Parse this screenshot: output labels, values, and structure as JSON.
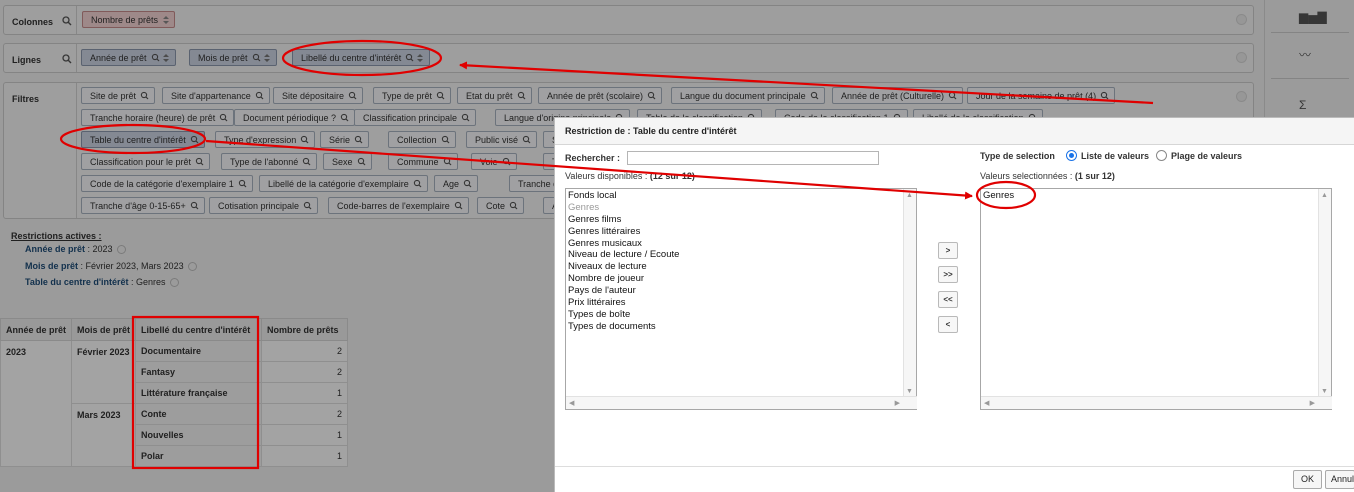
{
  "zones": {
    "colonnes": {
      "label": "Colonnes",
      "chips": [
        "Nombre de prêts"
      ]
    },
    "lignes": {
      "label": "Lignes",
      "chips": [
        "Année de prêt",
        "Mois de prêt",
        "Libellé du centre d'intérêt"
      ]
    },
    "filtres": {
      "label": "Filtres",
      "rows": [
        [
          "Site de prêt",
          "Site d'appartenance",
          "Site dépositaire",
          "Type de prêt",
          "Etat du prêt",
          "Année de prêt (scolaire)",
          "Langue du document principale",
          "Année de prêt (Culturelle)",
          "Jour de la semaine de prêt (4)"
        ],
        [
          "Tranche horaire (heure) de prêt",
          "Document périodique ?",
          "Classification principale",
          "Langue d'origine principale",
          "Table de la classification",
          "Code de la classification 1",
          "Libellé de la classification"
        ],
        [
          "Table du centre d'intérêt",
          "Type d'expression",
          "Série",
          "Collection",
          "Public visé",
          "S"
        ],
        [
          "Classification pour le prêt",
          "Type de l'abonné",
          "Sexe",
          "Commune",
          "Voie",
          "Ta"
        ],
        [
          "Code de la catégorie d'exemplaire 1",
          "Libellé de la catégorie d'exemplaire",
          "Age",
          "Tranche d'"
        ],
        [
          "Tranche d'âge 0-15-65+",
          "Cotisation principale",
          "Code-barres de l'exemplaire",
          "Cote",
          "A"
        ]
      ]
    }
  },
  "right_strip": {
    "icons": [
      "bar-chart-icon",
      "line-chart-icon",
      "sigma-icon"
    ],
    "glyphs": [
      "▆▅▇",
      "〰",
      "Σ"
    ]
  },
  "restrictions": {
    "title": "Restrictions actives :",
    "items": [
      {
        "label": "Année de prêt",
        "value": "2023"
      },
      {
        "label": "Mois de prêt",
        "value": "Février 2023, Mars 2023"
      },
      {
        "label": "Table du centre d'intérêt",
        "value": "Genres"
      }
    ]
  },
  "results": {
    "headers": [
      "Année de prêt",
      "Mois de prêt",
      "Libellé du centre d'intérêt",
      "Nombre de prêts"
    ],
    "year": "2023",
    "groups": [
      {
        "month": "Février 2023",
        "rows": [
          {
            "label": "Documentaire",
            "count": "2"
          },
          {
            "label": "Fantasy",
            "count": "2"
          },
          {
            "label": "Littérature française",
            "count": "1"
          }
        ]
      },
      {
        "month": "Mars 2023",
        "rows": [
          {
            "label": "Conte",
            "count": "2"
          },
          {
            "label": "Nouvelles",
            "count": "1"
          },
          {
            "label": "Polar",
            "count": "1"
          }
        ]
      }
    ]
  },
  "modal": {
    "title": "Restriction de : Table du centre d'intérêt",
    "search_label": "Rechercher :",
    "search_value": "",
    "selection_type_label": "Type de selection",
    "option_values": "Liste de valeurs",
    "option_range": "Plage de valeurs",
    "selected_option": "Liste de valeurs",
    "available_label": "Valeurs disponibles :",
    "available_count": "(12 sur 12)",
    "selected_label": "Valeurs selectionnées :",
    "selected_count": "(1 sur 12)",
    "available_items": [
      "Fonds local",
      "Genres",
      "Genres films",
      "Genres littéraires",
      "Genres musicaux",
      "Niveau de lecture / Ecoute",
      "Niveaux de lecture",
      "Nombre de joueur",
      "Pays de l'auteur",
      "Prix littéraires",
      "Types de boîte",
      "Types de documents"
    ],
    "selected_items": [
      "Genres"
    ],
    "move_buttons": [
      ">",
      ">>",
      "<<",
      "<"
    ],
    "ok_label": "OK",
    "cancel_label": "Annuler"
  },
  "annotation_color": "#e00000"
}
